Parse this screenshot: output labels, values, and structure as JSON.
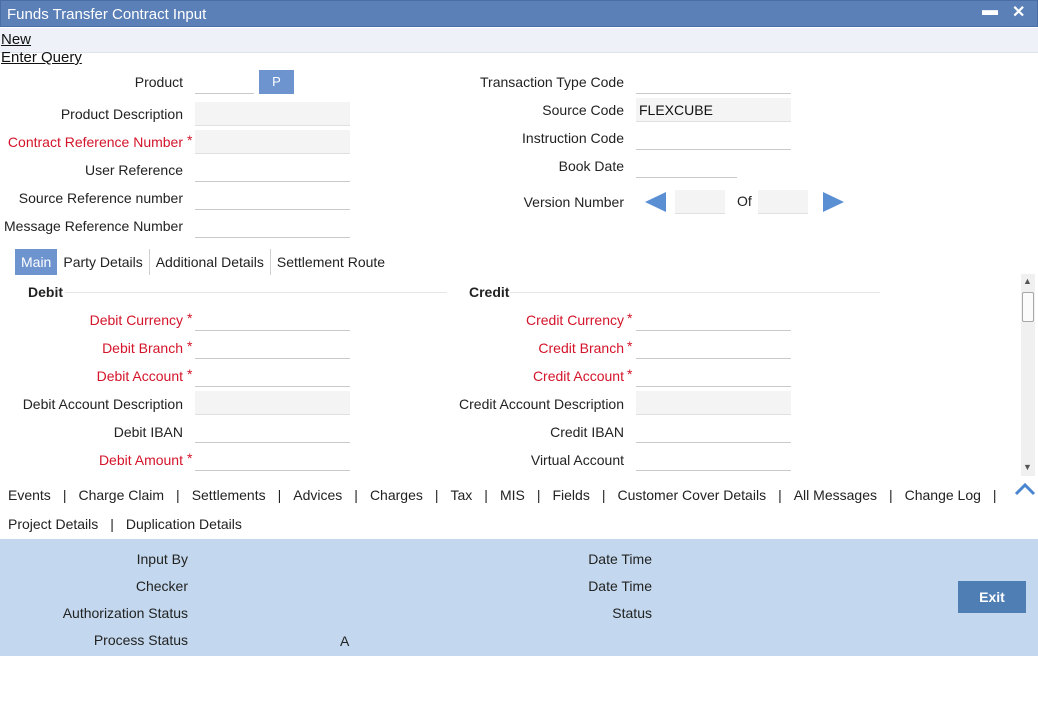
{
  "window": {
    "title": "Funds Transfer Contract Input",
    "minimize": "▬",
    "close": "✕"
  },
  "menu": {
    "new": "New",
    "enter_query": "Enter Query"
  },
  "header": {
    "product_label": "Product",
    "product_button": "P",
    "product_description_label": "Product Description",
    "contract_reference_label": "Contract Reference Number",
    "user_reference_label": "User Reference",
    "source_reference_label": "Source Reference number",
    "message_reference_label": "Message Reference Number",
    "transaction_type_label": "Transaction Type Code",
    "source_code_label": "Source Code",
    "source_code_value": "FLEXCUBE",
    "instruction_code_label": "Instruction Code",
    "book_date_label": "Book Date",
    "version_label": "Version Number",
    "of_label": "Of",
    "required_mark": "*"
  },
  "tabs": [
    "Main",
    "Party Details",
    "Additional Details",
    "Settlement Route"
  ],
  "main": {
    "debit_title": "Debit",
    "credit_title": "Credit",
    "debit": {
      "currency": "Debit Currency",
      "branch": "Debit Branch",
      "account": "Debit Account",
      "account_description": "Debit Account Description",
      "iban": "Debit IBAN",
      "amount": "Debit Amount"
    },
    "credit": {
      "currency": "Credit Currency",
      "branch": "Credit Branch",
      "account": "Credit Account",
      "account_description": "Credit Account Description",
      "iban": "Credit IBAN",
      "virtual_account": "Virtual Account"
    }
  },
  "links": {
    "row1": [
      "Events",
      "Charge Claim",
      "Settlements",
      "Advices",
      "Charges",
      "Tax",
      "MIS",
      "Fields",
      "Customer Cover Details",
      "All Messages",
      "Change Log"
    ],
    "row2": [
      "Project Details",
      "Duplication Details"
    ],
    "separator": "|"
  },
  "footer": {
    "input_by": "Input By",
    "checker": "Checker",
    "authorization_status": "Authorization Status",
    "process_status": "Process Status",
    "process_status_value": "A",
    "date_time_1": "Date Time",
    "date_time_2": "Date Time",
    "status": "Status",
    "exit": "Exit"
  },
  "colors": {
    "titlebar": "#5b7fb7",
    "accent": "#6d94cf",
    "required": "#d4142a",
    "footer_bg": "#c3d8ee",
    "exit_button": "#4f7eb5"
  }
}
